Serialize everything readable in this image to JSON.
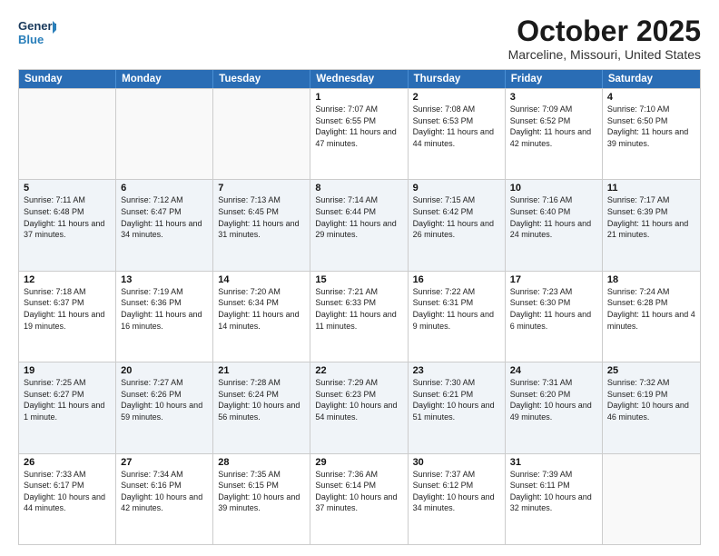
{
  "header": {
    "logo_general": "General",
    "logo_blue": "Blue",
    "month_title": "October 2025",
    "location": "Marceline, Missouri, United States"
  },
  "days_of_week": [
    "Sunday",
    "Monday",
    "Tuesday",
    "Wednesday",
    "Thursday",
    "Friday",
    "Saturday"
  ],
  "rows": [
    [
      {
        "day": "",
        "info": ""
      },
      {
        "day": "",
        "info": ""
      },
      {
        "day": "",
        "info": ""
      },
      {
        "day": "1",
        "info": "Sunrise: 7:07 AM\nSunset: 6:55 PM\nDaylight: 11 hours and 47 minutes."
      },
      {
        "day": "2",
        "info": "Sunrise: 7:08 AM\nSunset: 6:53 PM\nDaylight: 11 hours and 44 minutes."
      },
      {
        "day": "3",
        "info": "Sunrise: 7:09 AM\nSunset: 6:52 PM\nDaylight: 11 hours and 42 minutes."
      },
      {
        "day": "4",
        "info": "Sunrise: 7:10 AM\nSunset: 6:50 PM\nDaylight: 11 hours and 39 minutes."
      }
    ],
    [
      {
        "day": "5",
        "info": "Sunrise: 7:11 AM\nSunset: 6:48 PM\nDaylight: 11 hours and 37 minutes."
      },
      {
        "day": "6",
        "info": "Sunrise: 7:12 AM\nSunset: 6:47 PM\nDaylight: 11 hours and 34 minutes."
      },
      {
        "day": "7",
        "info": "Sunrise: 7:13 AM\nSunset: 6:45 PM\nDaylight: 11 hours and 31 minutes."
      },
      {
        "day": "8",
        "info": "Sunrise: 7:14 AM\nSunset: 6:44 PM\nDaylight: 11 hours and 29 minutes."
      },
      {
        "day": "9",
        "info": "Sunrise: 7:15 AM\nSunset: 6:42 PM\nDaylight: 11 hours and 26 minutes."
      },
      {
        "day": "10",
        "info": "Sunrise: 7:16 AM\nSunset: 6:40 PM\nDaylight: 11 hours and 24 minutes."
      },
      {
        "day": "11",
        "info": "Sunrise: 7:17 AM\nSunset: 6:39 PM\nDaylight: 11 hours and 21 minutes."
      }
    ],
    [
      {
        "day": "12",
        "info": "Sunrise: 7:18 AM\nSunset: 6:37 PM\nDaylight: 11 hours and 19 minutes."
      },
      {
        "day": "13",
        "info": "Sunrise: 7:19 AM\nSunset: 6:36 PM\nDaylight: 11 hours and 16 minutes."
      },
      {
        "day": "14",
        "info": "Sunrise: 7:20 AM\nSunset: 6:34 PM\nDaylight: 11 hours and 14 minutes."
      },
      {
        "day": "15",
        "info": "Sunrise: 7:21 AM\nSunset: 6:33 PM\nDaylight: 11 hours and 11 minutes."
      },
      {
        "day": "16",
        "info": "Sunrise: 7:22 AM\nSunset: 6:31 PM\nDaylight: 11 hours and 9 minutes."
      },
      {
        "day": "17",
        "info": "Sunrise: 7:23 AM\nSunset: 6:30 PM\nDaylight: 11 hours and 6 minutes."
      },
      {
        "day": "18",
        "info": "Sunrise: 7:24 AM\nSunset: 6:28 PM\nDaylight: 11 hours and 4 minutes."
      }
    ],
    [
      {
        "day": "19",
        "info": "Sunrise: 7:25 AM\nSunset: 6:27 PM\nDaylight: 11 hours and 1 minute."
      },
      {
        "day": "20",
        "info": "Sunrise: 7:27 AM\nSunset: 6:26 PM\nDaylight: 10 hours and 59 minutes."
      },
      {
        "day": "21",
        "info": "Sunrise: 7:28 AM\nSunset: 6:24 PM\nDaylight: 10 hours and 56 minutes."
      },
      {
        "day": "22",
        "info": "Sunrise: 7:29 AM\nSunset: 6:23 PM\nDaylight: 10 hours and 54 minutes."
      },
      {
        "day": "23",
        "info": "Sunrise: 7:30 AM\nSunset: 6:21 PM\nDaylight: 10 hours and 51 minutes."
      },
      {
        "day": "24",
        "info": "Sunrise: 7:31 AM\nSunset: 6:20 PM\nDaylight: 10 hours and 49 minutes."
      },
      {
        "day": "25",
        "info": "Sunrise: 7:32 AM\nSunset: 6:19 PM\nDaylight: 10 hours and 46 minutes."
      }
    ],
    [
      {
        "day": "26",
        "info": "Sunrise: 7:33 AM\nSunset: 6:17 PM\nDaylight: 10 hours and 44 minutes."
      },
      {
        "day": "27",
        "info": "Sunrise: 7:34 AM\nSunset: 6:16 PM\nDaylight: 10 hours and 42 minutes."
      },
      {
        "day": "28",
        "info": "Sunrise: 7:35 AM\nSunset: 6:15 PM\nDaylight: 10 hours and 39 minutes."
      },
      {
        "day": "29",
        "info": "Sunrise: 7:36 AM\nSunset: 6:14 PM\nDaylight: 10 hours and 37 minutes."
      },
      {
        "day": "30",
        "info": "Sunrise: 7:37 AM\nSunset: 6:12 PM\nDaylight: 10 hours and 34 minutes."
      },
      {
        "day": "31",
        "info": "Sunrise: 7:39 AM\nSunset: 6:11 PM\nDaylight: 10 hours and 32 minutes."
      },
      {
        "day": "",
        "info": ""
      }
    ]
  ]
}
